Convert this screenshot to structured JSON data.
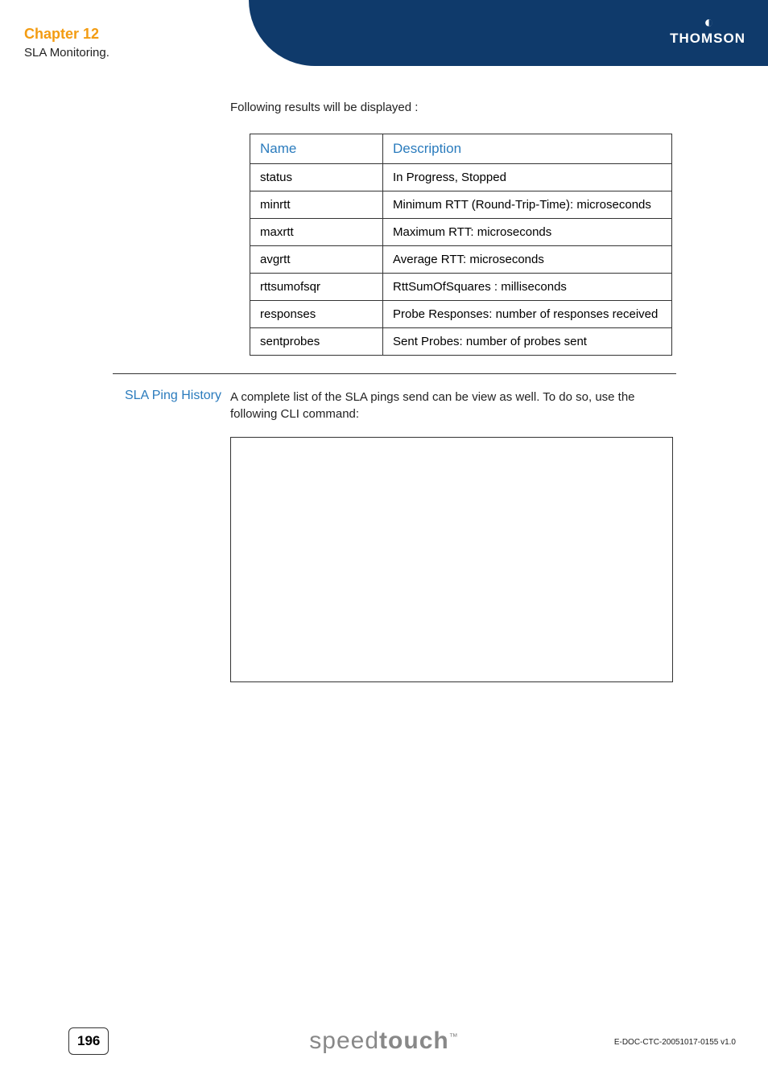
{
  "header": {
    "chapter": "Chapter 12",
    "subtitle": "SLA Monitoring.",
    "brand": "THOMSON"
  },
  "intro_text": "Following results will be displayed :",
  "table": {
    "header": {
      "name": "Name",
      "description": "Description"
    },
    "rows": [
      {
        "name": "status",
        "description": "In Progress, Stopped"
      },
      {
        "name": "minrtt",
        "description": "Minimum RTT (Round-Trip-Time): microseconds"
      },
      {
        "name": "maxrtt",
        "description": "Maximum RTT: microseconds"
      },
      {
        "name": "avgrtt",
        "description": "Average RTT: microseconds"
      },
      {
        "name": "rttsumofsqr",
        "description": "RttSumOfSquares : milliseconds"
      },
      {
        "name": "responses",
        "description": "Probe Responses: number of responses received"
      },
      {
        "name": "sentprobes",
        "description": "Sent Probes: number of probes sent"
      }
    ]
  },
  "section2": {
    "heading": "SLA Ping History",
    "body": "A complete list of the SLA pings send can be view as well. To do so, use the following CLI command:"
  },
  "footer": {
    "page_number": "196",
    "product_light": "speed",
    "product_bold": "touch",
    "tm": "™",
    "doc_id": "E-DOC-CTC-20051017-0155 v1.0"
  }
}
